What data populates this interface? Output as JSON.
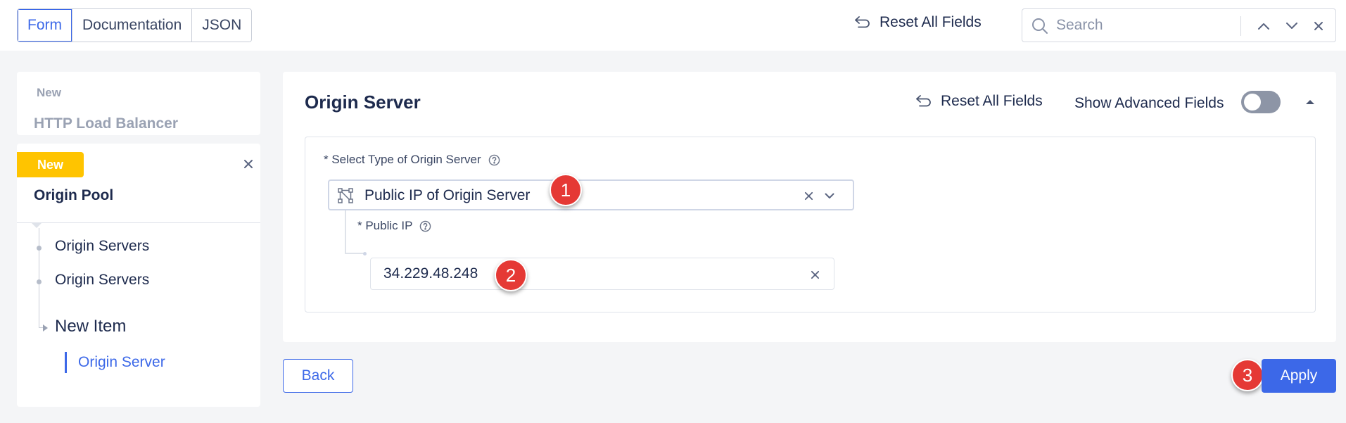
{
  "topbar": {
    "tabs": [
      {
        "label": "Form",
        "active": true
      },
      {
        "label": "Documentation",
        "active": false
      },
      {
        "label": "JSON",
        "active": false
      }
    ],
    "reset_label": "Reset All Fields",
    "search": {
      "placeholder": "Search",
      "value": ""
    }
  },
  "sidebar": {
    "load_balancer": {
      "badge": "New",
      "title": "HTTP Load Balancer"
    },
    "origin_pool": {
      "badge": "New",
      "title": "Origin Pool",
      "items": [
        {
          "label": "Origin Servers"
        },
        {
          "label": "Origin Servers"
        },
        {
          "label": "New Item"
        }
      ],
      "active_leaf": "Origin Server"
    }
  },
  "main": {
    "title": "Origin Server",
    "reset_label": "Reset All Fields",
    "advanced_label": "Show Advanced Fields",
    "advanced_enabled": false,
    "type_field": {
      "label": "* Select Type of Origin Server",
      "value": "Public IP of Origin Server"
    },
    "ip_field": {
      "label": "* Public IP",
      "value": "34.229.48.248"
    }
  },
  "steps": [
    "1",
    "2",
    "3"
  ],
  "buttons": {
    "back": "Back",
    "apply": "Apply"
  },
  "colors": {
    "accent": "#3c68e8",
    "badge_yellow": "#ffc400",
    "step_red": "#e53935"
  }
}
